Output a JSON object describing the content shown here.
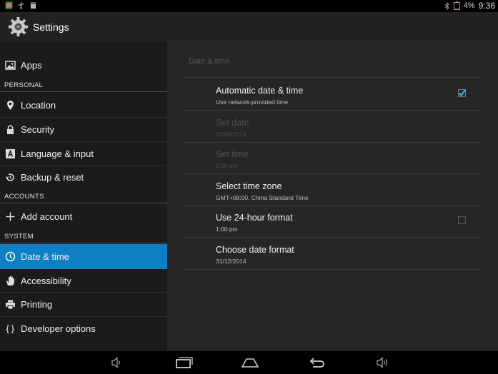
{
  "status_bar": {
    "battery_text": "4%",
    "time": "9:36",
    "icons": [
      "app-notification-icon",
      "usb-icon",
      "sd-card-icon",
      "bluetooth-icon",
      "battery-icon"
    ]
  },
  "action_bar": {
    "title": "Settings",
    "icon": "settings-gear-icon"
  },
  "sidebar": {
    "items": [
      {
        "label": "Apps",
        "icon": "apps-icon"
      },
      {
        "header": "PERSONAL"
      },
      {
        "label": "Location",
        "icon": "location-pin-icon"
      },
      {
        "label": "Security",
        "icon": "lock-icon"
      },
      {
        "label": "Language & input",
        "icon": "language-icon"
      },
      {
        "label": "Backup & reset",
        "icon": "backup-icon"
      },
      {
        "header": "ACCOUNTS"
      },
      {
        "label": "Add account",
        "icon": "plus-icon"
      },
      {
        "header": "SYSTEM"
      },
      {
        "label": "Date & time",
        "icon": "clock-icon",
        "selected": true
      },
      {
        "label": "Accessibility",
        "icon": "hand-icon"
      },
      {
        "label": "Printing",
        "icon": "printer-icon"
      },
      {
        "label": "Developer options",
        "icon": "braces-icon"
      }
    ]
  },
  "main": {
    "section_title": "Date & time",
    "rows": [
      {
        "title": "Automatic date & time",
        "summary": "Use network-provided time",
        "checkbox": true,
        "checked": true,
        "enabled": true
      },
      {
        "title": "Set date",
        "summary": "22/05/2014",
        "enabled": false
      },
      {
        "title": "Set time",
        "summary": "9:36 am",
        "enabled": false
      },
      {
        "title": "Select time zone",
        "summary": "GMT+08:00, China Standard Time",
        "enabled": true
      },
      {
        "title": "Use 24-hour format",
        "summary": "1:00 pm",
        "checkbox": true,
        "checked": false,
        "enabled": true
      },
      {
        "title": "Choose date format",
        "summary": "31/12/2014",
        "enabled": true
      }
    ]
  },
  "nav_bar": {
    "buttons": [
      "volume-down-icon",
      "recent-apps-icon",
      "home-icon",
      "back-icon",
      "volume-up-icon"
    ]
  },
  "colors": {
    "accent": "#0d7fc2",
    "checkmark": "#33b5e5"
  }
}
